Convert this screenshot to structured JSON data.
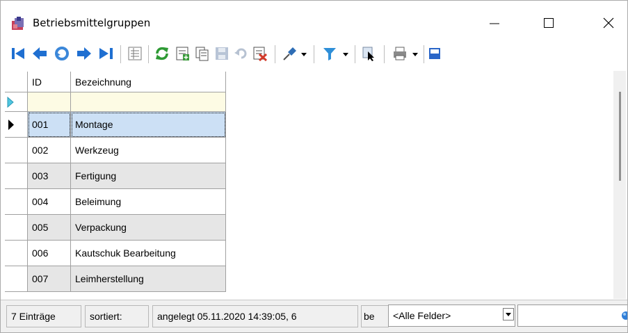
{
  "window": {
    "title": "Betriebsmittelgruppen",
    "controls": [
      "minimize-icon",
      "maximize-icon",
      "close-icon"
    ]
  },
  "toolbar": {
    "buttons": [
      "first-record-icon",
      "previous-record-icon",
      "refresh-cycle-icon",
      "next-record-icon",
      "last-record-icon",
      "list-view-icon",
      "reload-icon",
      "new-record-icon",
      "copy-record-icon",
      "save-icon",
      "undo-icon",
      "delete-icon",
      "pin-icon",
      "pin-dropdown-icon",
      "filter-icon",
      "filter-dropdown-icon",
      "select-cursor-icon",
      "print-icon",
      "print-dropdown-icon",
      "extra-icon"
    ]
  },
  "grid": {
    "columns": [
      "ID",
      "Bezeichnung"
    ],
    "rows": [
      {
        "id": "001",
        "name": "Montage"
      },
      {
        "id": "002",
        "name": "Werkzeug"
      },
      {
        "id": "003",
        "name": "Fertigung"
      },
      {
        "id": "004",
        "name": "Beleimung"
      },
      {
        "id": "005",
        "name": "Verpackung"
      },
      {
        "id": "006",
        "name": "Kautschuk Bearbeitung"
      },
      {
        "id": "007",
        "name": "Leimherstellung"
      }
    ],
    "selected_index": 0,
    "colors": {
      "new_row": "#fdfbe4",
      "selected": "#cce0f5",
      "alt_row": "#e6e6e6",
      "grid_line": "#a0a0a0"
    }
  },
  "status": {
    "count": "7 Einträge",
    "sorted": "sortiert:",
    "created": "angelegt 05.11.2020 14:39:05,  6",
    "search_prefix": "be",
    "field_select": "<Alle Felder>"
  }
}
